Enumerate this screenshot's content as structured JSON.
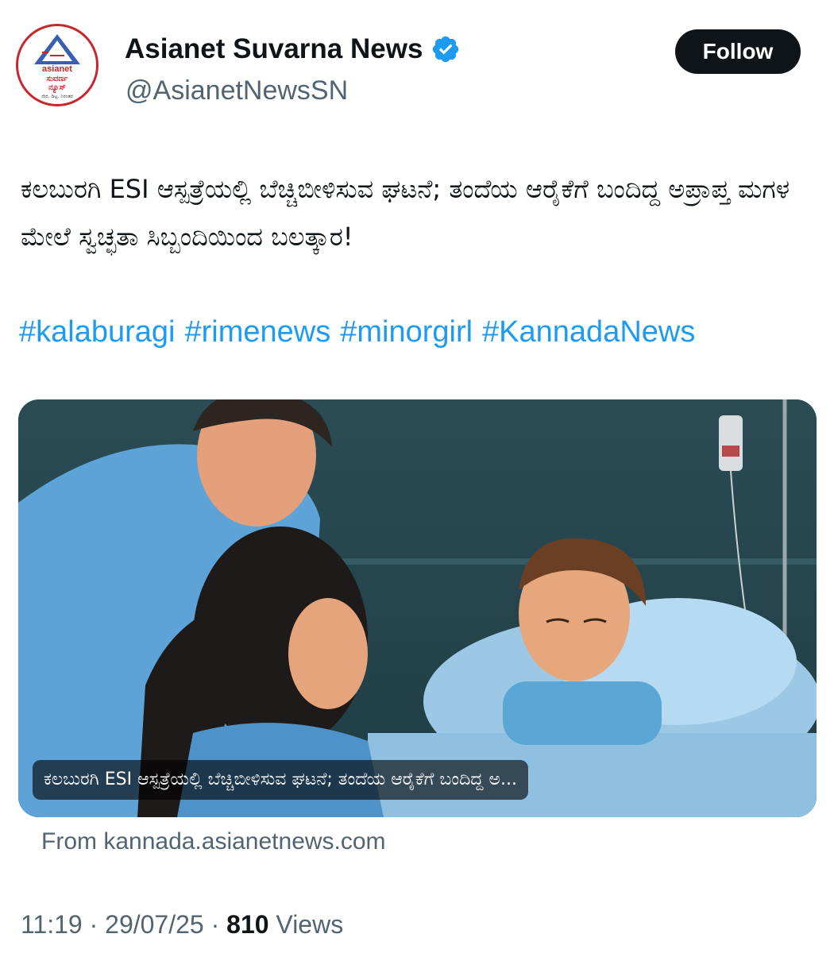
{
  "account": {
    "display_name": "Asianet Suvarna News",
    "handle": "@AsianetNewsSN",
    "verified": true,
    "avatar_text": {
      "line1": "asianet",
      "line2": "ಸುವರ್ಣ",
      "line3": "ನ್ಯೂಸ್",
      "tagline": "ನೇರ. ದಿಟ್ಟ. ನಿರಂತರ"
    },
    "follow_label": "Follow"
  },
  "tweet": {
    "text": "ಕಲಬುರಗಿ ESI ಆಸ್ಪತ್ರೆಯಲ್ಲಿ ಬೆಚ್ಚಿಬೀಳಿಸುವ ಘಟನೆ; ತಂದೆಯ ಆರೈಕೆಗೆ ಬಂದಿದ್ದ ಅಪ್ರಾಪ್ತ ಮಗಳ ಮೇಲೆ ಸ್ವಚ್ಛತಾ ಸಿಬ್ಬಂದಿಯಿಂದ ಬಲತ್ಕಾರ!",
    "hashtags": [
      "#kalaburagi",
      "#rimenews",
      "#minorgirl",
      "#KannadaNews"
    ]
  },
  "link_card": {
    "caption": "ಕಲಬುರಗಿ ESI ಆಸ್ಪತ್ರೆಯಲ್ಲಿ ಬೆಚ್ಚಿಬೀಳಿಸುವ ಘಟನೆ; ತಂದೆಯ ಆರೈಕೆಗೆ ಬಂದಿದ್ದ ಅ...",
    "source": "From kannada.asianetnews.com"
  },
  "meta": {
    "time": "11:19",
    "separator": "·",
    "date": "29/07/25",
    "views_count": "810",
    "views_label": "Views"
  },
  "colors": {
    "link": "#1d9bf0",
    "verified": "#1d9bf0",
    "brand_red": "#c8262d",
    "follow_bg": "#0f1419"
  }
}
